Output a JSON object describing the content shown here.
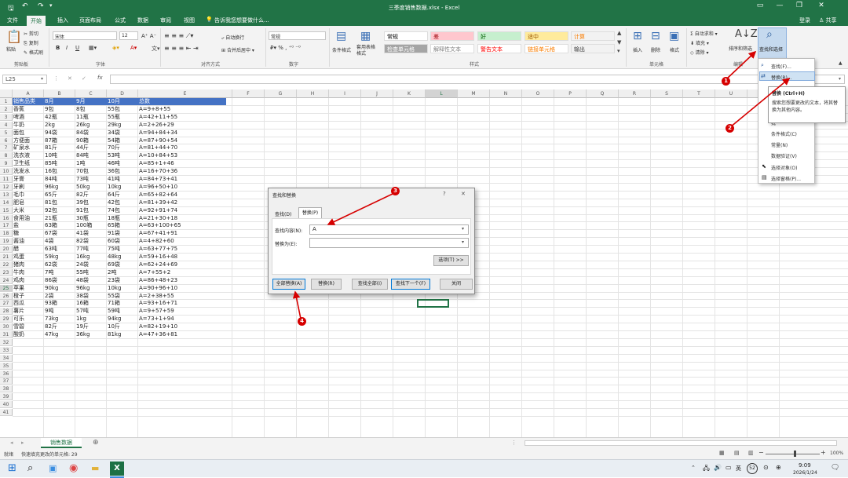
{
  "window": {
    "title": "三季度销售数据.xlsx - Excel",
    "login": "登录",
    "share": "共享"
  },
  "ribbon_tabs": [
    "文件",
    "开始",
    "插入",
    "页面布局",
    "公式",
    "数据",
    "审阅",
    "视图"
  ],
  "tell_me": "告诉我您想要做什么...",
  "clipboard": {
    "paste": "粘贴",
    "cut": "剪切",
    "copy": "复制",
    "format_painter": "格式刷",
    "label": "剪贴板"
  },
  "font": {
    "name": "宋体",
    "size": "12",
    "label": "字体",
    "bold": "B",
    "italic": "I",
    "underline": "U"
  },
  "alignment": {
    "wrap": "自动换行",
    "merge": "合并后居中",
    "label": "对齐方式"
  },
  "number": {
    "format": "常规",
    "label": "数字",
    "percent": "%",
    "comma": ","
  },
  "styles_group": {
    "conditional": "条件格式",
    "table_format": "套用表格格式",
    "label": "样式",
    "cells": [
      {
        "text": "常规",
        "bg": "#ffffff",
        "color": "#000000"
      },
      {
        "text": "差",
        "bg": "#ffc7ce",
        "color": "#9c0006"
      },
      {
        "text": "好",
        "bg": "#c6efce",
        "color": "#006100"
      },
      {
        "text": "适中",
        "bg": "#ffeb9c",
        "color": "#9c5700"
      },
      {
        "text": "计算",
        "bg": "#f2f2f2",
        "color": "#fa7d00"
      },
      {
        "text": "检查单元格",
        "bg": "#a5a5a5",
        "color": "#ffffff"
      },
      {
        "text": "解释性文本",
        "bg": "#ffffff",
        "color": "#7f7f7f"
      },
      {
        "text": "警告文本",
        "bg": "#ffffff",
        "color": "#ff0000"
      },
      {
        "text": "链接单元格",
        "bg": "#ffffff",
        "color": "#fa7d00"
      },
      {
        "text": "输出",
        "bg": "#f2f2f2",
        "color": "#3f3f3f"
      }
    ]
  },
  "cells_group": {
    "insert": "插入",
    "delete": "删除",
    "format": "格式",
    "label": "单元格"
  },
  "editing_group": {
    "autosum": "自动求和",
    "fill": "填充",
    "clear": "清除",
    "sort": "排序和筛选",
    "find": "查找和选择",
    "label": "编辑"
  },
  "formula_bar": {
    "name_box": "L25",
    "fx": "fx",
    "cancel": "✕",
    "enter": "✓"
  },
  "columns": [
    "A",
    "B",
    "C",
    "D",
    "E",
    "F",
    "G",
    "H",
    "I",
    "J",
    "K",
    "L",
    "M",
    "N",
    "O",
    "P",
    "Q",
    "R",
    "S",
    "T",
    "U",
    "V"
  ],
  "table": {
    "header": [
      "销售品类",
      "8月",
      "9月",
      "10月",
      "总数"
    ],
    "rows": [
      [
        "香蕉",
        "9包",
        "8包",
        "55包",
        "A=9+8+55"
      ],
      [
        "啤酒",
        "42瓶",
        "11瓶",
        "55瓶",
        "A=42+11+55"
      ],
      [
        "牛奶",
        "2kg",
        "26kg",
        "29kg",
        "A=2+26+29"
      ],
      [
        "面包",
        "94袋",
        "84袋",
        "34袋",
        "A=94+84+34"
      ],
      [
        "方便面",
        "87箱",
        "90箱",
        "54箱",
        "A=87+90+54"
      ],
      [
        "矿泉水",
        "81斤",
        "44斤",
        "70斤",
        "A=81+44+70"
      ],
      [
        "洗衣液",
        "10吨",
        "84吨",
        "53吨",
        "A=10+84+53"
      ],
      [
        "卫生纸",
        "85吨",
        "1吨",
        "46吨",
        "A=85+1+46"
      ],
      [
        "洗发水",
        "16包",
        "70包",
        "36包",
        "A=16+70+36"
      ],
      [
        "牙膏",
        "84吨",
        "73吨",
        "41吨",
        "A=84+73+41"
      ],
      [
        "牙刷",
        "96kg",
        "50kg",
        "10kg",
        "A=96+50+10"
      ],
      [
        "毛巾",
        "65斤",
        "82斤",
        "64斤",
        "A=65+82+64"
      ],
      [
        "肥皂",
        "81包",
        "39包",
        "42包",
        "A=81+39+42"
      ],
      [
        "大米",
        "92包",
        "91包",
        "74包",
        "A=92+91+74"
      ],
      [
        "食用油",
        "21瓶",
        "30瓶",
        "18瓶",
        "A=21+30+18"
      ],
      [
        "盐",
        "63箱",
        "100箱",
        "65箱",
        "A=63+100+65"
      ],
      [
        "糖",
        "67袋",
        "41袋",
        "91袋",
        "A=67+41+91"
      ],
      [
        "酱油",
        "4袋",
        "82袋",
        "60袋",
        "A=4+82+60"
      ],
      [
        "醋",
        "63吨",
        "77吨",
        "75吨",
        "A=63+77+75"
      ],
      [
        "鸡蛋",
        "59kg",
        "16kg",
        "48kg",
        "A=59+16+48"
      ],
      [
        "猪肉",
        "62袋",
        "24袋",
        "69袋",
        "A=62+24+69"
      ],
      [
        "牛肉",
        "7吨",
        "55吨",
        "2吨",
        "A=7+55+2"
      ],
      [
        "鸡肉",
        "86袋",
        "48袋",
        "23袋",
        "A=86+48+23"
      ],
      [
        "苹果",
        "90kg",
        "96kg",
        "10kg",
        "A=90+96+10"
      ],
      [
        "橙子",
        "2袋",
        "38袋",
        "55袋",
        "A=2+38+55"
      ],
      [
        "西瓜",
        "93箱",
        "16箱",
        "71箱",
        "A=93+16+71"
      ],
      [
        "薯片",
        "9吨",
        "57吨",
        "59吨",
        "A=9+57+59"
      ],
      [
        "可乐",
        "73kg",
        "1kg",
        "94kg",
        "A=73+1+94"
      ],
      [
        "雪碧",
        "82斤",
        "19斤",
        "10斤",
        "A=82+19+10"
      ],
      [
        "酸奶",
        "47kg",
        "36kg",
        "81kg",
        "A=47+36+81"
      ]
    ]
  },
  "dialog": {
    "title": "查找和替换",
    "help": "?",
    "close": "✕",
    "tab_find": "查找(D)",
    "tab_replace": "替换(P)",
    "find_label": "查找内容(N):",
    "find_value": "A",
    "replace_label": "替换为(E):",
    "replace_value": "",
    "options": "选项(T) >>",
    "replace_all": "全部替换(A)",
    "replace": "替换(R)",
    "find_all": "查找全部(I)",
    "find_next": "查找下一个(F)",
    "close_btn": "关闭"
  },
  "find_menu": {
    "items": [
      "查找(F)...",
      "替换(R)...",
      "转",
      "定",
      "公",
      "批",
      "条件格式(C)",
      "常量(N)",
      "数据验证(V)",
      "选择对象(O)",
      "选择窗格(P)..."
    ]
  },
  "tooltip": {
    "title": "替换 (Ctrl+H)",
    "body": "搜索您想要更改的文本，将其替换为其他内容。"
  },
  "sheet": {
    "tab": "销售数据",
    "add": "⊕"
  },
  "status": {
    "mode": "就绪",
    "message": "快速填充更改的单元格: 29",
    "zoom": "100%"
  },
  "taskbar": {
    "time": "9:09",
    "date": "2026/1/24",
    "lang": "英",
    "badge": "52"
  },
  "annotations": [
    "1",
    "2",
    "3",
    "4"
  ],
  "colors": {
    "excel_green": "#217346",
    "header_blue": "#4472c4",
    "annotation_red": "#d60000"
  }
}
